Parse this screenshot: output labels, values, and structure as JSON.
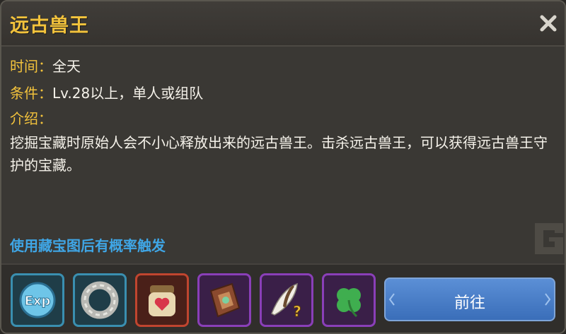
{
  "dialog": {
    "title": "远古兽王",
    "time": {
      "label": "时间：",
      "value": "全天"
    },
    "condition": {
      "label": "条件：",
      "value": "Lv.28以上，单人或组队"
    },
    "intro": {
      "label": "介绍："
    },
    "description": "挖掘宝藏时原始人会不小心释放出来的远古兽王。击杀远古兽王，可以获得远古兽王守护的宝藏。",
    "hint": "使用藏宝图后有概率触发",
    "go_label": "前往"
  },
  "rewards": [
    {
      "icon": "exp-icon",
      "rarity_color": "#3a8fb0"
    },
    {
      "icon": "iron-ring-icon",
      "rarity_color": "#3a8fb0"
    },
    {
      "icon": "heart-jar-icon",
      "rarity_color": "#c0452f"
    },
    {
      "icon": "skill-book-icon",
      "rarity_color": "#8a3fb8"
    },
    {
      "icon": "mystery-feather-icon",
      "rarity_color": "#8a3fb8"
    },
    {
      "icon": "four-leaf-clover-icon",
      "rarity_color": "#8a3fb8"
    }
  ],
  "colors": {
    "title": "#f2c23c",
    "label": "#f2c23c",
    "hint": "#3fa6e6",
    "button": "#4a80c8"
  }
}
